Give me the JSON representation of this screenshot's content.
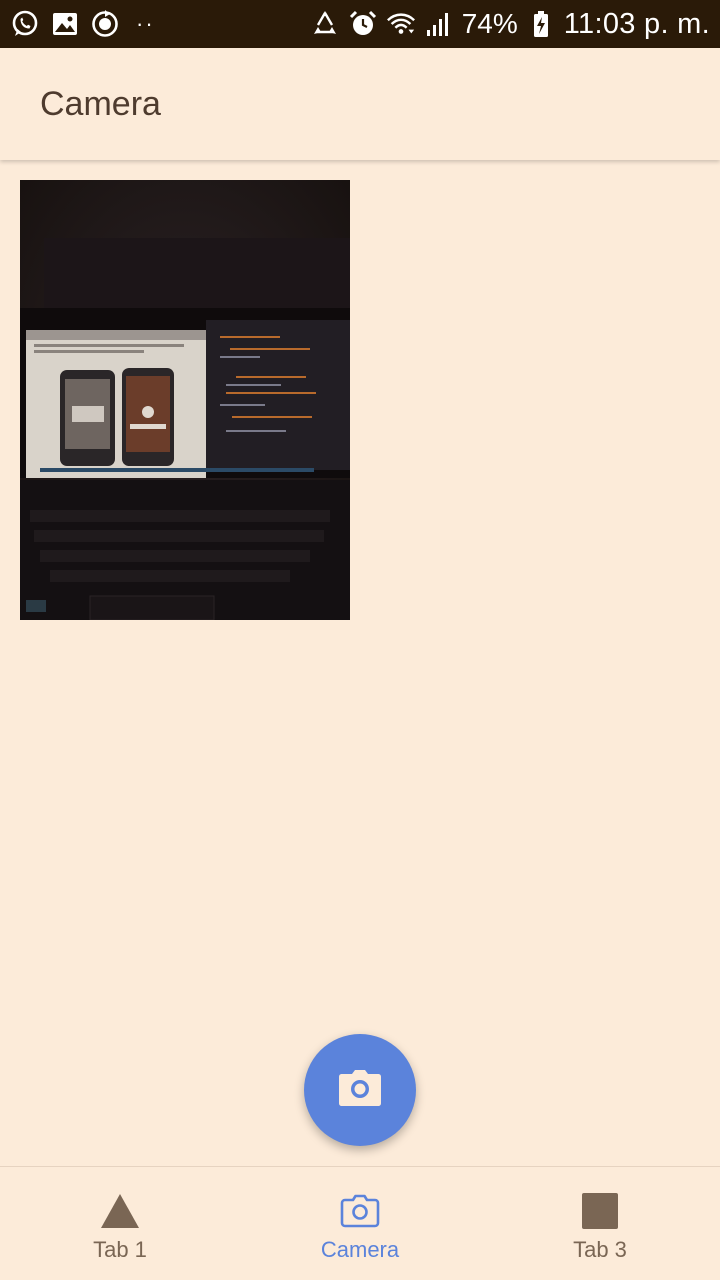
{
  "status_bar": {
    "battery": "74%",
    "time": "11:03 p. m.",
    "left_icons": [
      "whatsapp-icon",
      "gallery-icon",
      "sync-icon",
      "more-dots-icon"
    ],
    "right_icons": [
      "recycle-icon",
      "alarm-icon",
      "wifi-icon",
      "signal-icon",
      "battery-charging-icon"
    ]
  },
  "app_bar": {
    "title": "Camera"
  },
  "gallery": {
    "photos": [
      {
        "description_icon": "photo-thumbnail"
      }
    ]
  },
  "fab": {
    "icon": "camera-icon",
    "color": "#5B83DB"
  },
  "tabs": [
    {
      "label": "Tab 1",
      "icon": "triangle-icon",
      "active": false
    },
    {
      "label": "Camera",
      "icon": "camera-icon",
      "active": true
    },
    {
      "label": "Tab 3",
      "icon": "square-icon",
      "active": false
    }
  ],
  "colors": {
    "background": "#FCEBD9",
    "status_bar": "#2A1A08",
    "title_text": "#4E3B2E",
    "accent": "#5B83DB",
    "tab_inactive": "#7A6654"
  }
}
